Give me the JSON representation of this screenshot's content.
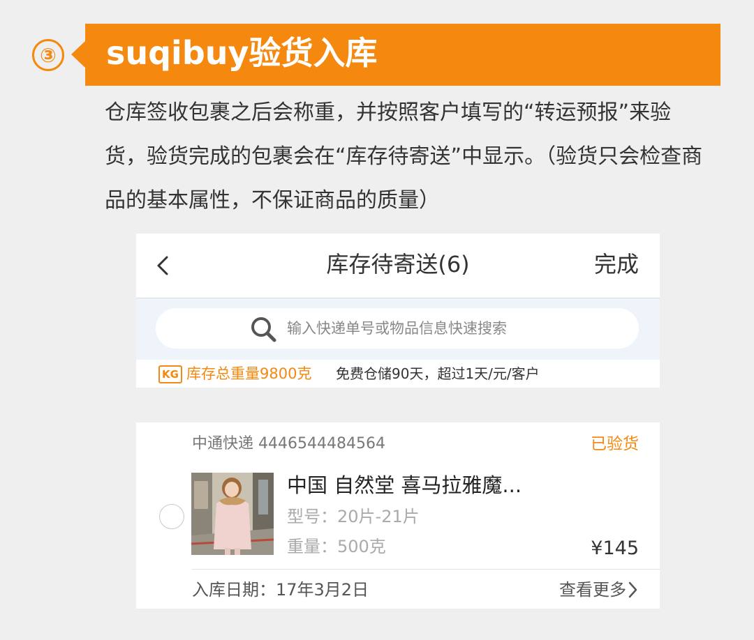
{
  "step": {
    "number": "③",
    "title": "suqibuy验货入库"
  },
  "description": "仓库签收包裹之后会称重，并按照客户填写的“转运预报”来验货，验货完成的包裹会在“库存待寄送”中显示。（验货只会检查商品的基本属性，不保证商品的质量）",
  "app": {
    "nav": {
      "title": "库存待寄送(6)",
      "done_label": "完成",
      "back_icon": "chevron-left-icon"
    },
    "search": {
      "placeholder": "输入快递单号或物品信息快速搜索",
      "icon": "search-icon"
    },
    "storage": {
      "badge": "KG",
      "total_weight": "库存总重量9800克",
      "free_storage": "免费仓储90天，超过1天/元/客户"
    },
    "package": {
      "courier": "中通快递 4446544484564",
      "status": "已验货",
      "product_name": "中国 自然堂 喜马拉雅魔...",
      "model": "型号：20片-21片",
      "weight": "重量：500克",
      "price": "¥145",
      "in_date": "入库日期：17年3月2日",
      "more_label": "查看更多"
    }
  },
  "colors": {
    "accent": "#f5880f",
    "background": "#efefef",
    "search_bg": "#eef4fa"
  }
}
